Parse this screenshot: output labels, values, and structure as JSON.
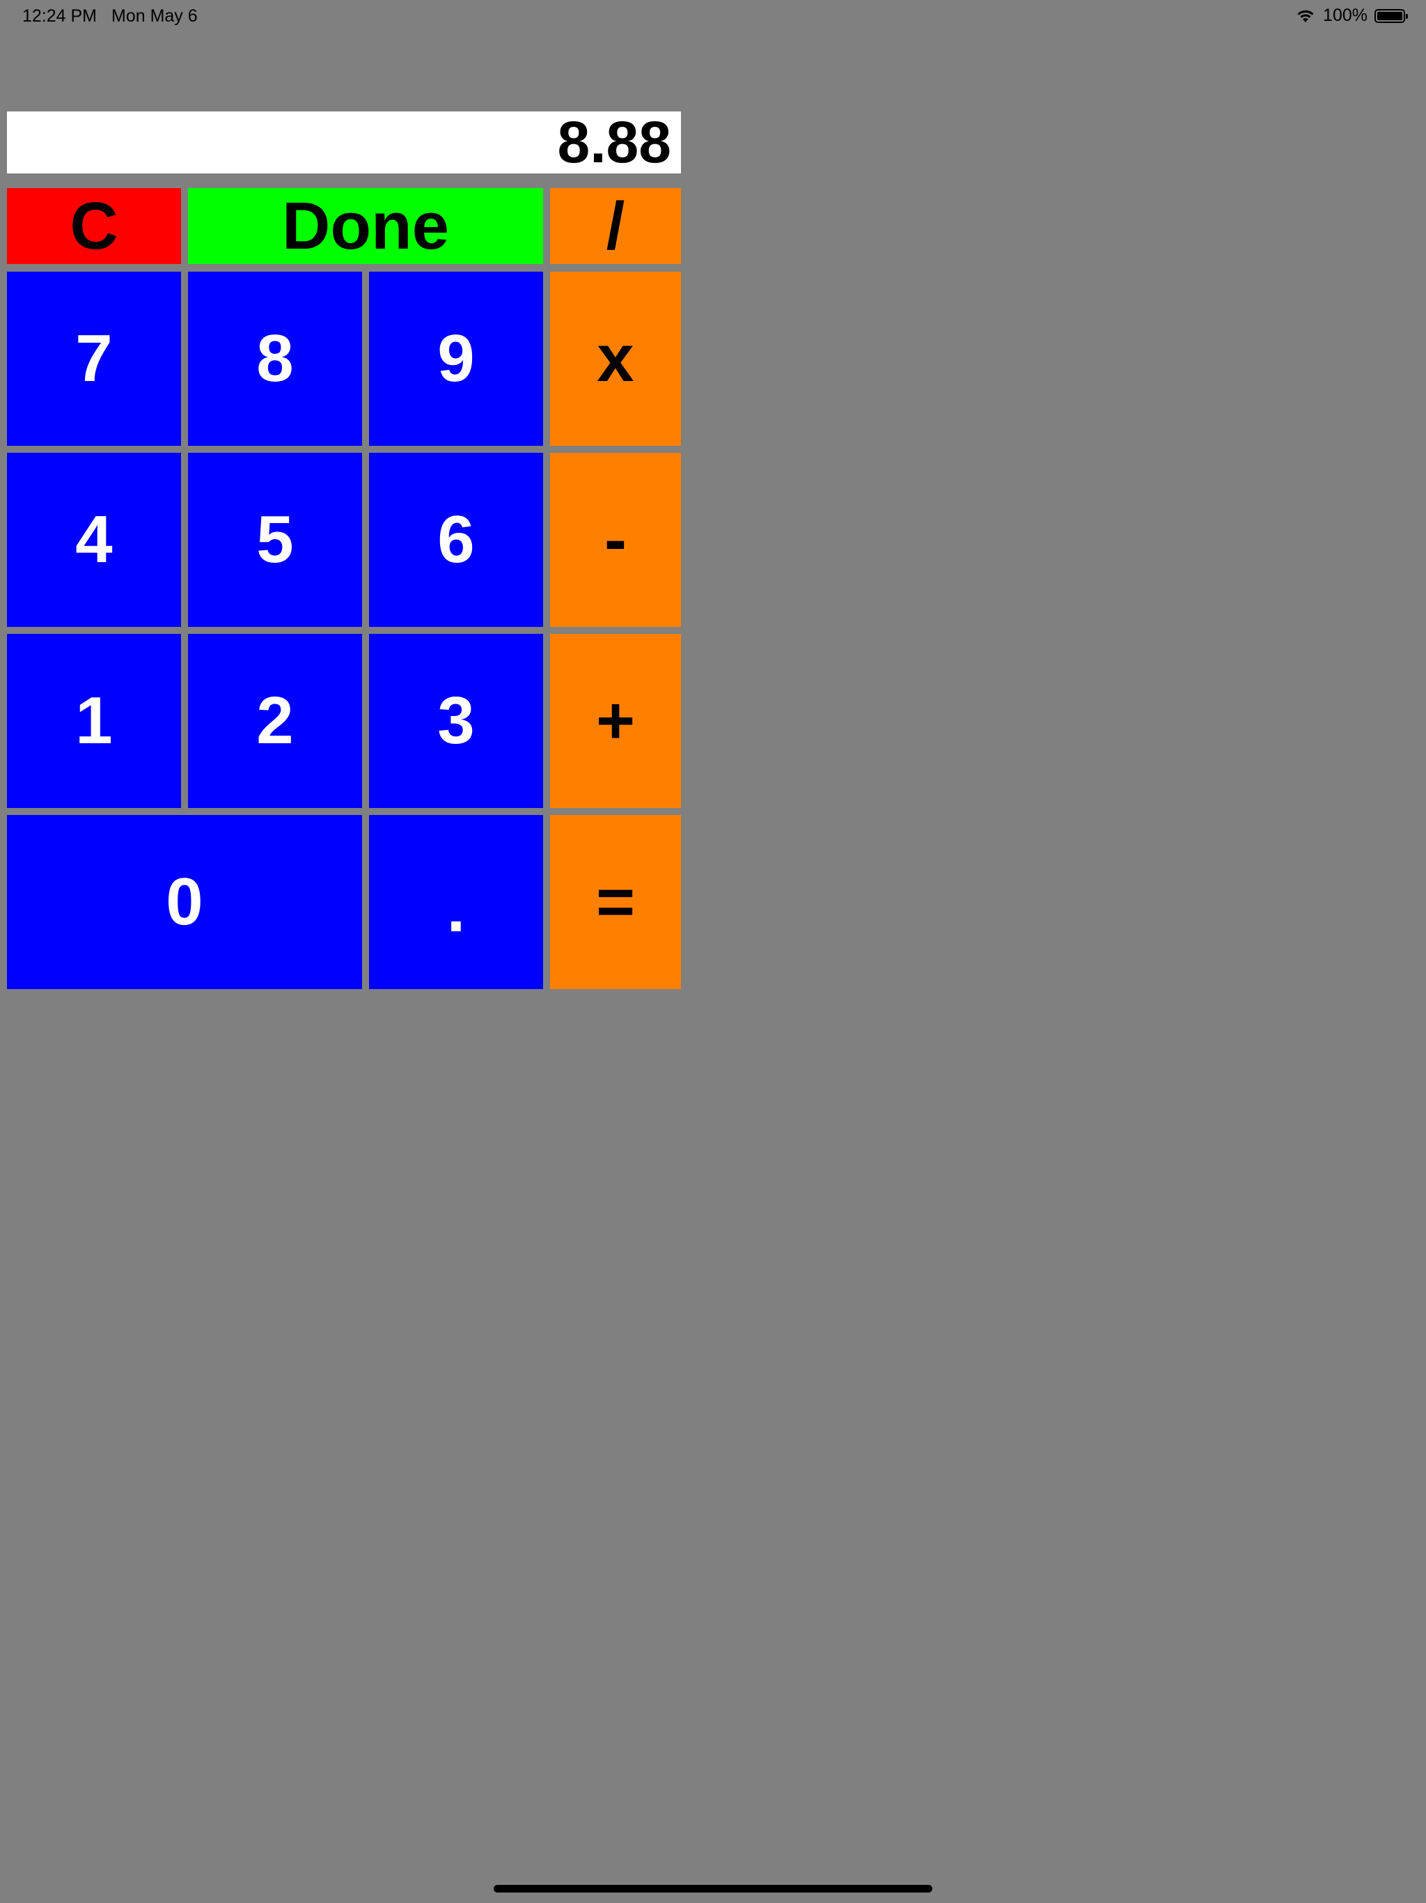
{
  "status_bar": {
    "time": "12:24 PM",
    "date": "Mon May 6",
    "battery": "100%"
  },
  "display": {
    "value": "8.88"
  },
  "keys": {
    "clear": "C",
    "done": "Done",
    "divide": "/",
    "seven": "7",
    "eight": "8",
    "nine": "9",
    "multiply": "x",
    "four": "4",
    "five": "5",
    "six": "6",
    "minus": "-",
    "one": "1",
    "two": "2",
    "three": "3",
    "plus": "+",
    "zero": "0",
    "decimal": ".",
    "equals": "="
  },
  "colors": {
    "background": "#808080",
    "number_key": "#0000ff",
    "operator_key": "#ff8000",
    "clear_key": "#ff0000",
    "done_key": "#00ff00",
    "display": "#ffffff"
  }
}
